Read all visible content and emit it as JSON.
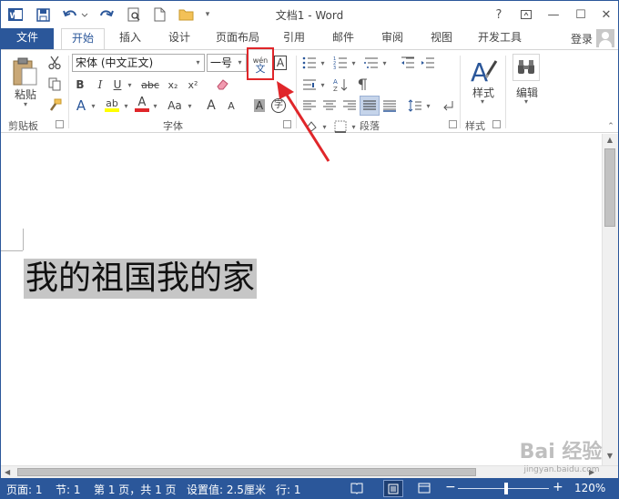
{
  "app": {
    "title": "文档1 - Word",
    "logo_text": "W"
  },
  "window": {
    "help": "?",
    "ribbon_display": "⬒",
    "minimize": "—",
    "maximize": "☐",
    "close": "✕"
  },
  "tabs": [
    {
      "label": "文件"
    },
    {
      "label": "开始"
    },
    {
      "label": "插入"
    },
    {
      "label": "设计"
    },
    {
      "label": "页面布局"
    },
    {
      "label": "引用"
    },
    {
      "label": "邮件"
    },
    {
      "label": "审阅"
    },
    {
      "label": "视图"
    },
    {
      "label": "开发工具"
    }
  ],
  "account": {
    "login": "登录"
  },
  "clipboard": {
    "label": "剪贴板",
    "paste": "粘贴"
  },
  "font": {
    "label": "字体",
    "name": "宋体 (中文正文)",
    "size": "一号",
    "phonetic_top": "wén",
    "phonetic_bottom": "文",
    "char_border": "A",
    "bold": "B",
    "italic": "I",
    "underline": "U",
    "strike": "abc",
    "subscript": "x₂",
    "superscript": "x²",
    "text_effect": "A",
    "highlight": "ab",
    "font_color": "A",
    "change_case": "Aa",
    "grow": "A",
    "shrink": "A",
    "char_shading": "A",
    "enclose": "字",
    "highlight_color": "#ffff00",
    "font_color_value": "#e0262a"
  },
  "paragraph": {
    "label": "段落"
  },
  "styles": {
    "label": "样式",
    "button": "样式"
  },
  "editing": {
    "button": "编辑"
  },
  "document": {
    "text": "我的祖国我的家"
  },
  "status": {
    "page": "页面: 1",
    "section": "节: 1",
    "page_of": "第 1 页，共 1 页",
    "setting": "设置值: 2.5厘米",
    "line": "行: 1",
    "zoom": "120%"
  },
  "watermark": {
    "line1": "Bai 经验",
    "line2": "jingyan.baidu.com"
  },
  "colors": {
    "accent": "#2b579a",
    "highlight_box": "#e0262a"
  }
}
